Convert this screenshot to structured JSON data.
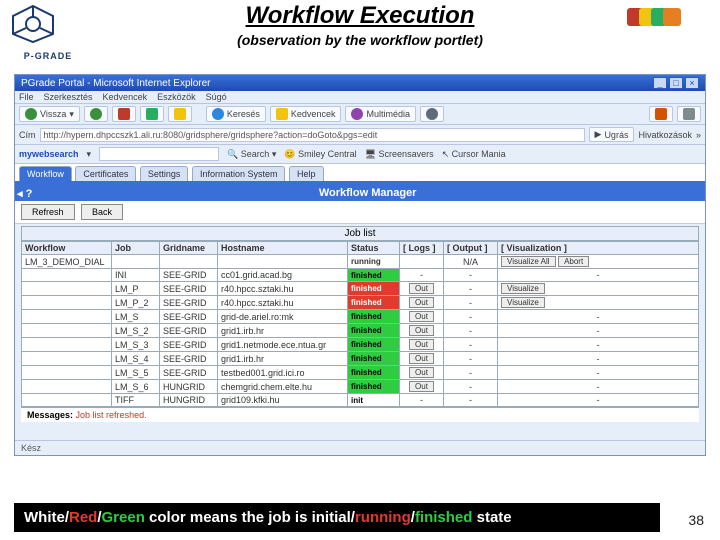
{
  "header": {
    "logo_text": "P-GRADE",
    "title": "Workflow Execution",
    "subtitle": "(observation by the workflow portlet)"
  },
  "browser": {
    "window_title": "PGrade Portal - Microsoft Internet Explorer",
    "menu": [
      "File",
      "Szerkesztés",
      "Kedvencek",
      "Eszközök",
      "Súgó"
    ],
    "toolbar": {
      "back": "Vissza",
      "search": "Keresés",
      "favorites": "Kedvencek",
      "media": "Multimédia"
    },
    "address_label": "Cím",
    "address_value": "http://hypern.dhpccszk1.ali.ru:8080/gridsphere/gridsphere?action=doGoto&pgs=edit",
    "go_label": "Ugrás",
    "links_label": "Hivatkozások",
    "search_brand": "mywebsearch",
    "search_opts": [
      "Search",
      "Smiley Central",
      "Screensavers",
      "Cursor Mania"
    ]
  },
  "portal": {
    "tabs": [
      "Workflow",
      "Certificates",
      "Settings",
      "Information System",
      "Help"
    ],
    "manager_title": "Workflow Manager",
    "buttons": {
      "refresh": "Refresh",
      "back": "Back"
    },
    "joblist_header": "Job list",
    "columns": {
      "workflow": "Workflow",
      "job": "Job",
      "gridname": "Gridname",
      "hostname": "Hostname",
      "status": "Status",
      "logs": "[ Logs ]",
      "output": "[ Output ]",
      "visualization": "[ Visualization ]"
    },
    "action_row": {
      "workflow": "LM_3_DEMO_DIAL",
      "status": "running",
      "output": "N/A",
      "viz_btn": "Visualize All",
      "abort_btn": "Abort"
    },
    "rows": [
      {
        "job": "INI",
        "grid": "SEE-GRID",
        "host": "cc01.grid.acad.bg",
        "status": "finished",
        "st_class": "st-fin",
        "logs": "-",
        "out": "-",
        "viz": "-"
      },
      {
        "job": "LM_P",
        "grid": "SEE-GRID",
        "host": "r40.hpcc.sztaki.hu",
        "status": "finished",
        "st_class": "st-run",
        "logs": "Out",
        "out": "-",
        "viz": "Visualize"
      },
      {
        "job": "LM_P_2",
        "grid": "SEE-GRID",
        "host": "r40.hpcc.sztaki.hu",
        "status": "finished",
        "st_class": "st-run",
        "logs": "Out",
        "out": "-",
        "viz": "Visualize"
      },
      {
        "job": "LM_S",
        "grid": "SEE-GRID",
        "host": "grid-de.ariel.ro:mk",
        "status": "finished",
        "st_class": "st-fin",
        "logs": "Out",
        "out": "-",
        "viz": "-"
      },
      {
        "job": "LM_S_2",
        "grid": "SEE-GRID",
        "host": "grid1.irb.hr",
        "status": "finished",
        "st_class": "st-fin",
        "logs": "Out",
        "out": "-",
        "viz": "-"
      },
      {
        "job": "LM_S_3",
        "grid": "SEE-GRID",
        "host": "grid1.netmode.ece.ntua.gr",
        "status": "finished",
        "st_class": "st-fin",
        "logs": "Out",
        "out": "-",
        "viz": "-"
      },
      {
        "job": "LM_S_4",
        "grid": "SEE-GRID",
        "host": "grid1.irb.hr",
        "status": "finished",
        "st_class": "st-fin",
        "logs": "Out",
        "out": "-",
        "viz": "-"
      },
      {
        "job": "LM_S_5",
        "grid": "SEE-GRID",
        "host": "testbed001.grid.ici.ro",
        "status": "finished",
        "st_class": "st-fin",
        "logs": "Out",
        "out": "-",
        "viz": "-"
      },
      {
        "job": "LM_S_6",
        "grid": "HUNGRID",
        "host": "chemgrid.chem.elte.hu",
        "status": "finished",
        "st_class": "st-fin",
        "logs": "Out",
        "out": "-",
        "viz": "-"
      },
      {
        "job": "TIFF",
        "grid": "HUNGRID",
        "host": "grid109.kfki.hu",
        "status": "init",
        "st_class": "st-init",
        "logs": "-",
        "out": "-",
        "viz": "-"
      }
    ],
    "message_label": "Messages:",
    "message_value": "Job list refreshed.",
    "status_line": "Kész"
  },
  "caption": {
    "w1": "White",
    "sep1": "/",
    "r": "Red",
    "sep2": "/",
    "g": "Green",
    "mid": " color means the job is ",
    "w2": "initial",
    "sep3": "/",
    "r2": "running",
    "sep4": "/",
    "g2": "finished",
    "end": " state"
  },
  "page_number": "38"
}
